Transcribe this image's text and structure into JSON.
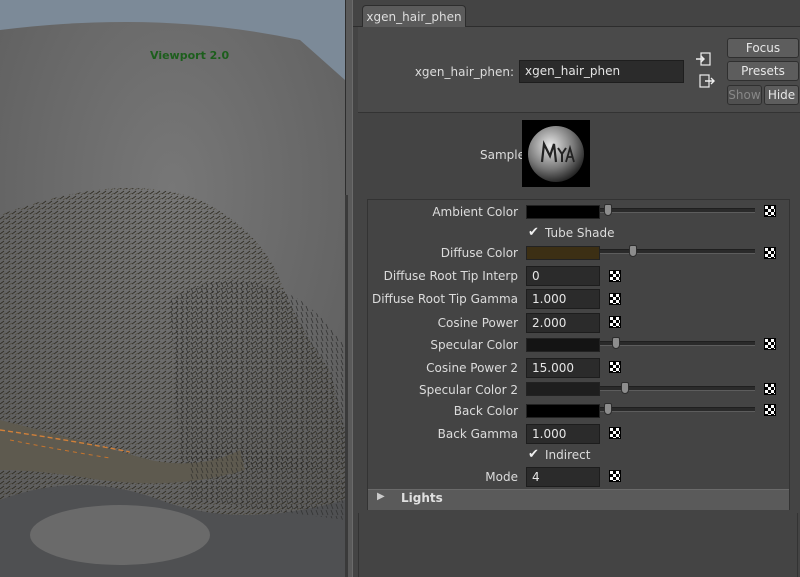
{
  "viewport": {
    "label": "Viewport 2.0"
  },
  "tab": {
    "label": "xgen_hair_phen"
  },
  "node": {
    "label": "xgen_hair_phen:",
    "value": "xgen_hair_phen"
  },
  "buttons": {
    "focus": "Focus",
    "presets": "Presets",
    "show": "Show",
    "hide": "Hide"
  },
  "sample": {
    "label": "Sample"
  },
  "attributes": {
    "ambient_color": {
      "label": "Ambient Color",
      "color": "#000000",
      "slider": 0.0
    },
    "tube_shade": {
      "label": "Tube Shade",
      "checked": true
    },
    "diffuse_color": {
      "label": "Diffuse Color",
      "color": "#3c2f14",
      "slider": 0.15
    },
    "diffuse_root_tip_interp": {
      "label": "Diffuse Root Tip Interp",
      "value": "0"
    },
    "diffuse_root_tip_gamma": {
      "label": "Diffuse Root Tip Gamma",
      "value": "1.000"
    },
    "cosine_power": {
      "label": "Cosine Power",
      "value": "2.000"
    },
    "specular_color": {
      "label": "Specular Color",
      "color": "#141414",
      "slider": 0.05
    },
    "cosine_power_2": {
      "label": "Cosine Power 2",
      "value": "15.000"
    },
    "specular_color_2": {
      "label": "Specular Color 2",
      "color": "#1e1e1e",
      "slider": 0.08
    },
    "back_color": {
      "label": "Back Color",
      "color": "#000000",
      "slider": 0.0
    },
    "back_gamma": {
      "label": "Back Gamma",
      "value": "1.000"
    },
    "indirect": {
      "label": "Indirect",
      "checked": true
    },
    "mode": {
      "label": "Mode",
      "value": "4"
    }
  },
  "sections": {
    "lights": "Lights"
  }
}
